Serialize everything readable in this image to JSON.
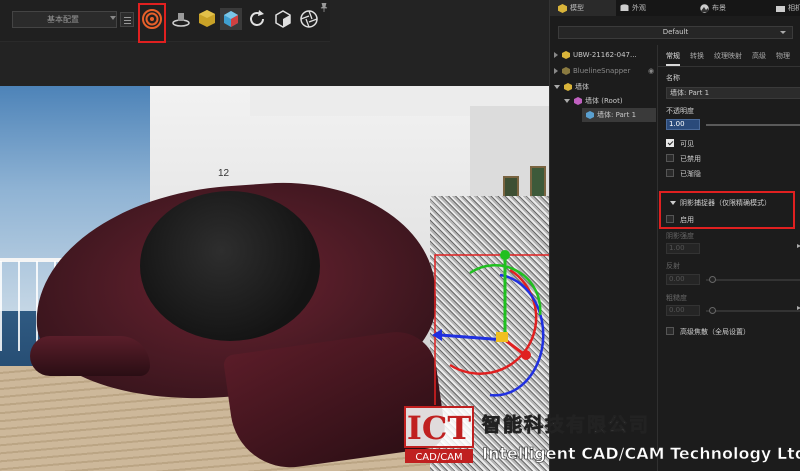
{
  "toolbar": {
    "preset_label": "基本配置",
    "icons": [
      "preset-menu-icon",
      "noise-render-icon",
      "turntable-icon",
      "material-cube-icon",
      "scene-cube-icon",
      "refresh-icon",
      "camera-cube-icon",
      "aperture-icon",
      "pin-icon"
    ],
    "highlight_color": "#e02020"
  },
  "panel": {
    "tabs": [
      {
        "label": "模型",
        "icon": "model-cube-icon"
      },
      {
        "label": "外观",
        "icon": "database-icon"
      },
      {
        "label": "布景",
        "icon": "landscape-icon"
      },
      {
        "label": "相机",
        "icon": "camera-icon"
      }
    ],
    "config_select": "Default",
    "tree": [
      {
        "label": "UBW-21162-047...",
        "icon": "model-cube-icon",
        "expander": "collapsed",
        "selected": false
      },
      {
        "label": "BluelineSnapper",
        "icon": "model-cube-icon",
        "expander": "collapsed",
        "selected": false,
        "dim": true
      },
      {
        "label": "墙体",
        "icon": "model-cube-icon",
        "expander": "expanded",
        "selected": false
      },
      {
        "label": "墙体 (Root)",
        "icon": "root-cube-icon",
        "expander": "expanded",
        "selected": false
      },
      {
        "label": "墙体: Part 1",
        "icon": "part-cube-icon",
        "expander": "none",
        "selected": true
      }
    ],
    "subtabs": [
      "常规",
      "转换",
      "纹理映射",
      "高级",
      "物理"
    ],
    "props": {
      "name_label": "名称",
      "name_value": "墙体: Part 1",
      "opacity_label": "不透明度",
      "opacity_value": "1.00",
      "visible_label": "可见",
      "disabled_label": "已禁用",
      "hidden_label": "已渐隐",
      "shadow_catcher_label": "阴影捕捉器（仅限精确模式）",
      "enable_label": "启用",
      "shadow_intensity_label": "阴影强度",
      "shadow_intensity_value": "1.00",
      "reflection_label": "反射",
      "reflection_value": "0.00",
      "roughness_label": "粗糙度",
      "roughness_value": "0.00",
      "ao_label": "高级焦散（全局设置）"
    }
  },
  "viewport": {
    "ship_number": "12"
  },
  "watermark": {
    "logo_text": "ICT",
    "logo_sub": "CAD/CAM",
    "chinese": "智能科技有限公司",
    "english": "Intelligent CAD/CAM Technology Ltd."
  }
}
